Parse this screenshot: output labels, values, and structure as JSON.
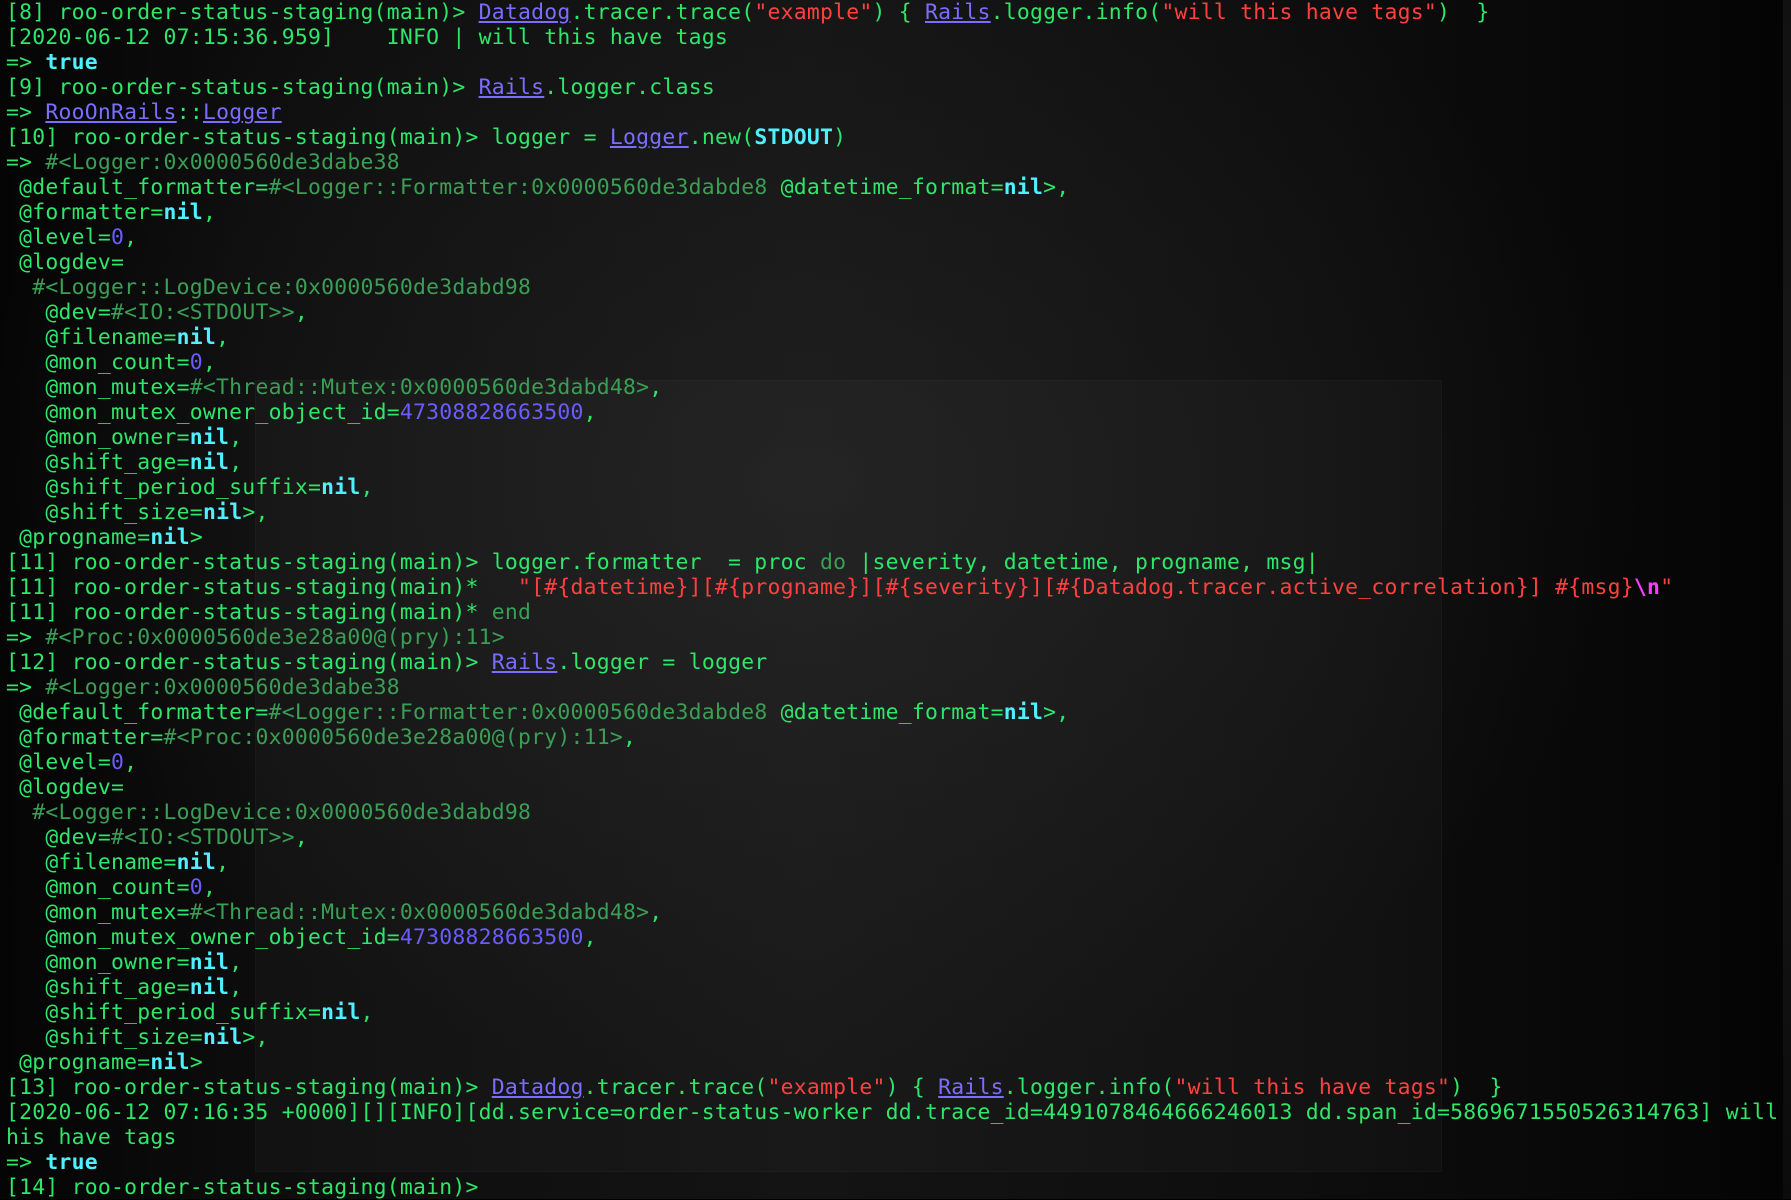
{
  "terminal": {
    "lines": [
      [
        [
          "g",
          "[8] roo-order-status-staging(main)> "
        ],
        [
          "u",
          "Datadog"
        ],
        [
          "g",
          ".tracer.trace("
        ],
        [
          "r",
          "\"example\""
        ],
        [
          "g",
          ") { "
        ],
        [
          "u",
          "Rails"
        ],
        [
          "g",
          ".logger.info("
        ],
        [
          "r",
          "\"will this have tags\""
        ],
        [
          "g",
          ")  }"
        ]
      ],
      [
        [
          "g",
          "[2020-06-12 07:15:36.959]    INFO | will this have tags"
        ]
      ],
      [
        [
          "g",
          "=> "
        ],
        [
          "c",
          "true"
        ]
      ],
      [
        [
          "g",
          "[9] roo-order-status-staging(main)> "
        ],
        [
          "u",
          "Rails"
        ],
        [
          "g",
          ".logger.class"
        ]
      ],
      [
        [
          "g",
          "=> "
        ],
        [
          "u",
          "RooOnRails"
        ],
        [
          "g",
          "::"
        ],
        [
          "u",
          "Logger"
        ]
      ],
      [
        [
          "g",
          "[10] roo-order-status-staging(main)> logger = "
        ],
        [
          "u",
          "Logger"
        ],
        [
          "g",
          ".new("
        ],
        [
          "c",
          "STDOUT"
        ],
        [
          "g",
          ")"
        ]
      ],
      [
        [
          "g",
          "=> "
        ],
        [
          "gr",
          "#<Logger:0x0000560de3dabe38"
        ]
      ],
      [
        [
          "g",
          " @default_formatter="
        ],
        [
          "gr",
          "#<Logger::Formatter:0x0000560de3dabde8"
        ],
        [
          "g",
          " @datetime_format="
        ],
        [
          "c",
          "nil"
        ],
        [
          "g",
          ">,"
        ]
      ],
      [
        [
          "g",
          " @formatter="
        ],
        [
          "c",
          "nil"
        ],
        [
          "g",
          ","
        ]
      ],
      [
        [
          "g",
          " @level="
        ],
        [
          "b",
          "0"
        ],
        [
          "g",
          ","
        ]
      ],
      [
        [
          "g",
          " @logdev="
        ]
      ],
      [
        [
          "gr",
          "  #<Logger::LogDevice:0x0000560de3dabd98"
        ]
      ],
      [
        [
          "g",
          "   @dev="
        ],
        [
          "gr",
          "#<IO:<STDOUT>>"
        ],
        [
          "g",
          ","
        ]
      ],
      [
        [
          "g",
          "   @filename="
        ],
        [
          "c",
          "nil"
        ],
        [
          "g",
          ","
        ]
      ],
      [
        [
          "g",
          "   @mon_count="
        ],
        [
          "b",
          "0"
        ],
        [
          "g",
          ","
        ]
      ],
      [
        [
          "g",
          "   @mon_mutex="
        ],
        [
          "gr",
          "#<Thread::Mutex:0x0000560de3dabd48>"
        ],
        [
          "g",
          ","
        ]
      ],
      [
        [
          "g",
          "   @mon_mutex_owner_object_id="
        ],
        [
          "b",
          "47308828663500"
        ],
        [
          "g",
          ","
        ]
      ],
      [
        [
          "g",
          "   @mon_owner="
        ],
        [
          "c",
          "nil"
        ],
        [
          "g",
          ","
        ]
      ],
      [
        [
          "g",
          "   @shift_age="
        ],
        [
          "c",
          "nil"
        ],
        [
          "g",
          ","
        ]
      ],
      [
        [
          "g",
          "   @shift_period_suffix="
        ],
        [
          "c",
          "nil"
        ],
        [
          "g",
          ","
        ]
      ],
      [
        [
          "g",
          "   @shift_size="
        ],
        [
          "c",
          "nil"
        ],
        [
          "g",
          ">,"
        ]
      ],
      [
        [
          "g",
          " @progname="
        ],
        [
          "c",
          "nil"
        ],
        [
          "g",
          ">"
        ]
      ],
      [
        [
          "g",
          "[11] roo-order-status-staging(main)> logger.formatter  = proc "
        ],
        [
          "gr",
          "do"
        ],
        [
          "g",
          " |severity, datetime, progname, msg|"
        ]
      ],
      [
        [
          "g",
          "[11] roo-order-status-staging(main)*   "
        ],
        [
          "r",
          "\"[#{datetime}][#{progname}][#{severity}][#{Datadog.tracer.active_correlation}] #{msg}"
        ],
        [
          "m",
          "\\n"
        ],
        [
          "r",
          "\""
        ]
      ],
      [
        [
          "g",
          "[11] roo-order-status-staging(main)* "
        ],
        [
          "gr",
          "end"
        ]
      ],
      [
        [
          "g",
          "=> "
        ],
        [
          "gr",
          "#<Proc:0x0000560de3e28a00@(pry):11>"
        ]
      ],
      [
        [
          "g",
          "[12] roo-order-status-staging(main)> "
        ],
        [
          "u",
          "Rails"
        ],
        [
          "g",
          ".logger = logger"
        ]
      ],
      [
        [
          "g",
          "=> "
        ],
        [
          "gr",
          "#<Logger:0x0000560de3dabe38"
        ]
      ],
      [
        [
          "g",
          " @default_formatter="
        ],
        [
          "gr",
          "#<Logger::Formatter:0x0000560de3dabde8"
        ],
        [
          "g",
          " @datetime_format="
        ],
        [
          "c",
          "nil"
        ],
        [
          "g",
          ">,"
        ]
      ],
      [
        [
          "g",
          " @formatter="
        ],
        [
          "gr",
          "#<Proc:0x0000560de3e28a00@(pry):11>"
        ],
        [
          "g",
          ","
        ]
      ],
      [
        [
          "g",
          " @level="
        ],
        [
          "b",
          "0"
        ],
        [
          "g",
          ","
        ]
      ],
      [
        [
          "g",
          " @logdev="
        ]
      ],
      [
        [
          "gr",
          "  #<Logger::LogDevice:0x0000560de3dabd98"
        ]
      ],
      [
        [
          "g",
          "   @dev="
        ],
        [
          "gr",
          "#<IO:<STDOUT>>"
        ],
        [
          "g",
          ","
        ]
      ],
      [
        [
          "g",
          "   @filename="
        ],
        [
          "c",
          "nil"
        ],
        [
          "g",
          ","
        ]
      ],
      [
        [
          "g",
          "   @mon_count="
        ],
        [
          "b",
          "0"
        ],
        [
          "g",
          ","
        ]
      ],
      [
        [
          "g",
          "   @mon_mutex="
        ],
        [
          "gr",
          "#<Thread::Mutex:0x0000560de3dabd48>"
        ],
        [
          "g",
          ","
        ]
      ],
      [
        [
          "g",
          "   @mon_mutex_owner_object_id="
        ],
        [
          "b",
          "47308828663500"
        ],
        [
          "g",
          ","
        ]
      ],
      [
        [
          "g",
          "   @mon_owner="
        ],
        [
          "c",
          "nil"
        ],
        [
          "g",
          ","
        ]
      ],
      [
        [
          "g",
          "   @shift_age="
        ],
        [
          "c",
          "nil"
        ],
        [
          "g",
          ","
        ]
      ],
      [
        [
          "g",
          "   @shift_period_suffix="
        ],
        [
          "c",
          "nil"
        ],
        [
          "g",
          ","
        ]
      ],
      [
        [
          "g",
          "   @shift_size="
        ],
        [
          "c",
          "nil"
        ],
        [
          "g",
          ">,"
        ]
      ],
      [
        [
          "g",
          " @progname="
        ],
        [
          "c",
          "nil"
        ],
        [
          "g",
          ">"
        ]
      ],
      [
        [
          "g",
          "[13] roo-order-status-staging(main)> "
        ],
        [
          "u",
          "Datadog"
        ],
        [
          "g",
          ".tracer.trace("
        ],
        [
          "r",
          "\"example\""
        ],
        [
          "g",
          ") { "
        ],
        [
          "u",
          "Rails"
        ],
        [
          "g",
          ".logger.info("
        ],
        [
          "r",
          "\"will this have tags\""
        ],
        [
          "g",
          ")  }"
        ]
      ],
      [
        [
          "g",
          "[2020-06-12 07:16:35 +0000][][INFO][dd.service=order-status-worker dd.trace_id=4491078464666246013 dd.span_id=5869671550526314763] will t"
        ]
      ],
      [
        [
          "g",
          "his have tags"
        ]
      ],
      [
        [
          "g",
          "=> "
        ],
        [
          "c",
          "true"
        ]
      ],
      [
        [
          "g",
          "[14] roo-order-status-staging(main)> "
        ]
      ]
    ]
  }
}
